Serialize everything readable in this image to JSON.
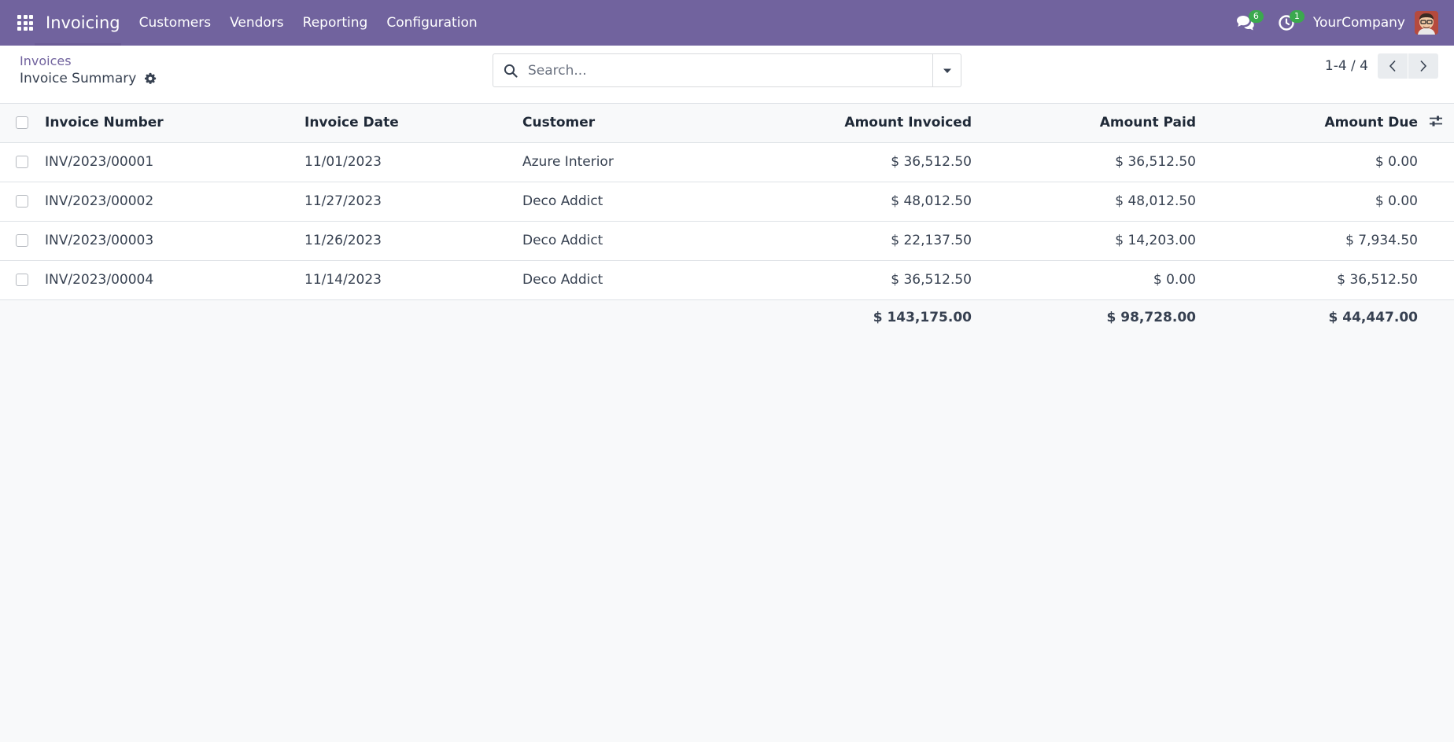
{
  "navbar": {
    "app_name": "Invoicing",
    "menu": [
      {
        "label": "Customers"
      },
      {
        "label": "Vendors"
      },
      {
        "label": "Reporting"
      },
      {
        "label": "Configuration"
      }
    ],
    "messages_count": "6",
    "activities_count": "1",
    "company": "YourCompany",
    "accent_color": "#71639e"
  },
  "control_panel": {
    "breadcrumb": "Invoices",
    "title": "Invoice Summary",
    "search_placeholder": "Search...",
    "pager": "1-4 / 4"
  },
  "table": {
    "columns": {
      "number": "Invoice Number",
      "date": "Invoice Date",
      "customer": "Customer",
      "invoiced": "Amount Invoiced",
      "paid": "Amount Paid",
      "due": "Amount Due"
    },
    "rows": [
      {
        "number": "INV/2023/00001",
        "date": "11/01/2023",
        "customer": "Azure Interior",
        "invoiced": "$ 36,512.50",
        "paid": "$ 36,512.50",
        "due": "$ 0.00"
      },
      {
        "number": "INV/2023/00002",
        "date": "11/27/2023",
        "customer": "Deco Addict",
        "invoiced": "$ 48,012.50",
        "paid": "$ 48,012.50",
        "due": "$ 0.00"
      },
      {
        "number": "INV/2023/00003",
        "date": "11/26/2023",
        "customer": "Deco Addict",
        "invoiced": "$ 22,137.50",
        "paid": "$ 14,203.00",
        "due": "$ 7,934.50"
      },
      {
        "number": "INV/2023/00004",
        "date": "11/14/2023",
        "customer": "Deco Addict",
        "invoiced": "$ 36,512.50",
        "paid": "$ 0.00",
        "due": "$ 36,512.50"
      }
    ],
    "totals": {
      "invoiced": "$ 143,175.00",
      "paid": "$ 98,728.00",
      "due": "$ 44,447.00"
    }
  }
}
